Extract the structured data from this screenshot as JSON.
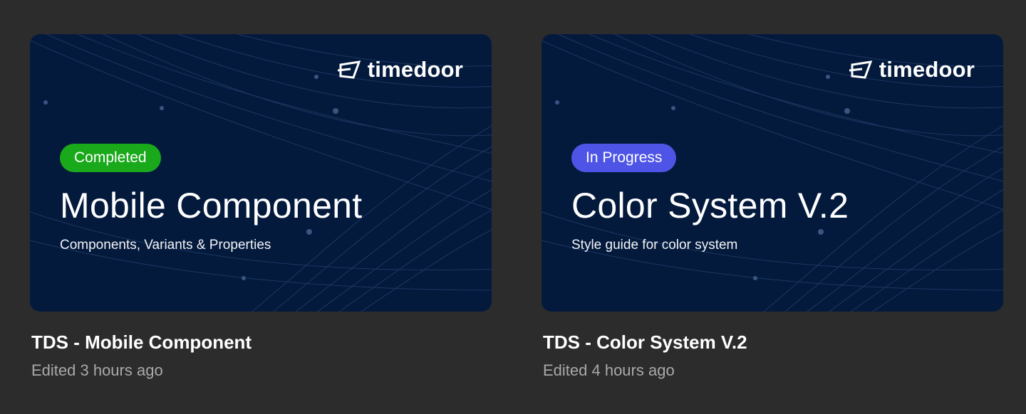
{
  "files": [
    {
      "brand": "timedoor",
      "status": "Completed",
      "status_color": "#19a91b",
      "title": "Mobile Component",
      "subtitle": "Components, Variants & Properties",
      "name": "TDS - Mobile Component",
      "edited": "Edited 3 hours ago"
    },
    {
      "brand": "timedoor",
      "status": "In Progress",
      "status_color": "#4e55e6",
      "title": "Color System V.2",
      "subtitle": "Style guide for color system",
      "name": "TDS - Color System V.2",
      "edited": "Edited 4 hours ago"
    }
  ],
  "colors": {
    "page_background": "#2c2c2c",
    "thumbnail_background": "#031a3d",
    "edited_text": "#a9a9a9"
  },
  "icons": {
    "brand_logo": "timedoor-logo-icon"
  }
}
